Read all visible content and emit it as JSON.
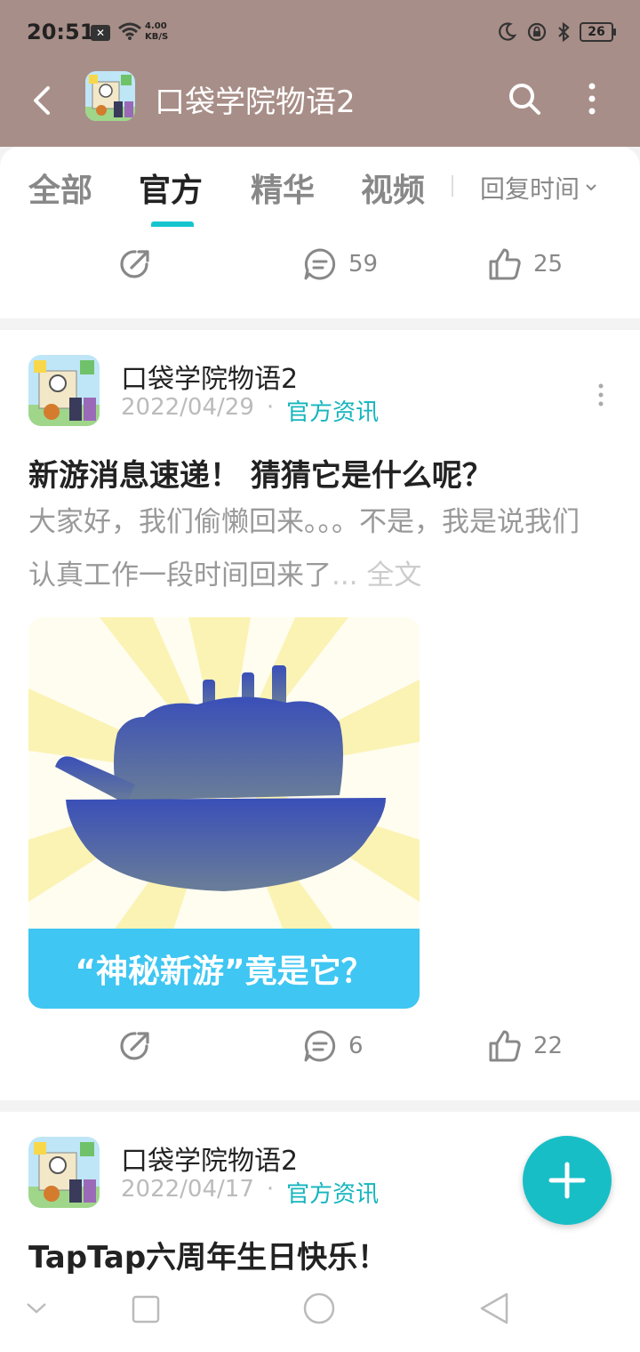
{
  "status_bar": {
    "time": "20:51",
    "network_speed_value": "4.00",
    "network_speed_unit": "KB/S",
    "battery": "26"
  },
  "app_bar": {
    "title": "口袋学院物语2",
    "icons": [
      "back-icon",
      "app-icon",
      "search-icon",
      "more-vertical-icon"
    ]
  },
  "tabs": {
    "items": [
      "全部",
      "官方",
      "精华",
      "视频"
    ],
    "active": "官方",
    "sort_label": "回复时间"
  },
  "posts": [
    {
      "share_icon": "share-icon",
      "comments": "59",
      "likes": "25"
    },
    {
      "author": "口袋学院物语2",
      "date": "2022/04/29",
      "separator": "·",
      "category": "官方资讯",
      "title": "新游消息速递！ 猜猜它是什么呢？",
      "excerpt": "大家好，我们偷懒回来。。。不是，我是说我们认真工作一段时间回来了",
      "ellipsis": "...",
      "read_more": "全文",
      "image_caption": "“神秘新游”竟是它？",
      "comments": "6",
      "likes": "22"
    },
    {
      "author": "口袋学院物语2",
      "date": "2022/04/17",
      "separator": "·",
      "category": "官方资讯",
      "title": "TapTap六周年生日快乐！"
    }
  ],
  "colors": {
    "header_bg": "#a88e88",
    "accent": "#15c5ce",
    "category_text": "#15b5be",
    "caption_bar": "#3fc6f2",
    "fab": "#18bec6"
  }
}
